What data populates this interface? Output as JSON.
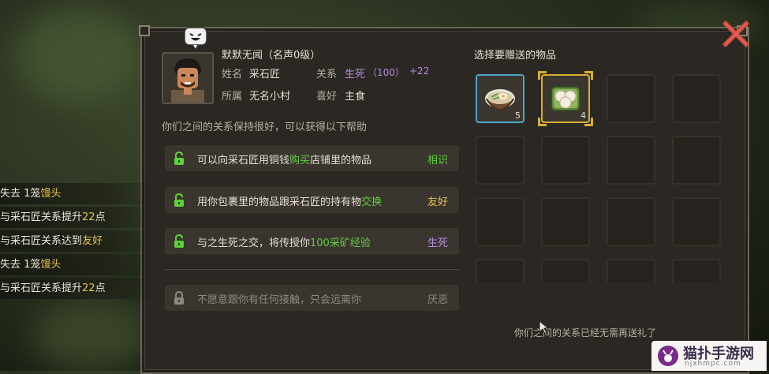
{
  "npc": {
    "name_line": "默默无闻（名声0级）",
    "name_label": "姓名",
    "name_value": "采石匠",
    "relation_label": "关系",
    "relation_level": "生死",
    "relation_points": "（100）",
    "relation_bonus": "+22",
    "belong_label": "所属",
    "belong_value": "无名小村",
    "hobby_label": "喜好",
    "hobby_value": "主食"
  },
  "relationship_text": "你们之间的关系保持很好，可以获得以下帮助",
  "benefits": [
    {
      "pre": "可以向采石匠用铜钱",
      "highlight": "购买",
      "post": "店铺里的物品",
      "level": "相识",
      "unlocked": true
    },
    {
      "pre": "用你包裹里的物品跟采石匠的持有物",
      "highlight": "交换",
      "post": "",
      "level": "友好",
      "unlocked": true
    },
    {
      "pre": "与之生死之交，将传授你",
      "highlight": "100采矿经验",
      "post": "",
      "level": "生死",
      "unlocked": true
    },
    {
      "pre": "不愿意跟你有任何接触，只会远离你",
      "highlight": "",
      "post": "",
      "level": "厌恶",
      "unlocked": false
    }
  ],
  "gift_panel": {
    "title": "选择要赠送的物品",
    "items": [
      {
        "name": "noodle-bowl",
        "count": "5"
      },
      {
        "name": "steamed-buns",
        "count": "4"
      }
    ],
    "footer": "你们之间的关系已经无需再送礼了"
  },
  "event_log": [
    {
      "pre": "失去 1笼",
      "highlight": "馒头",
      "post": ""
    },
    {
      "pre": "与采石匠关系提升",
      "highlight": "22",
      "post": "点"
    },
    {
      "pre": "与采石匠关系达到",
      "highlight": "友好",
      "post": ""
    },
    {
      "pre": "失去 1笼",
      "highlight": "馒头",
      "post": ""
    },
    {
      "pre": "与采石匠关系提升",
      "highlight": "22",
      "post": "点"
    }
  ],
  "watermark": {
    "main": "猫扑手游网",
    "sub": "njxhmpc.com"
  },
  "colors": {
    "green": "#5fcf3c",
    "purple": "#b98be6",
    "yellow": "#e8c14a",
    "blue_border": "#4aa6c8",
    "gold_border": "#d8ae34"
  }
}
